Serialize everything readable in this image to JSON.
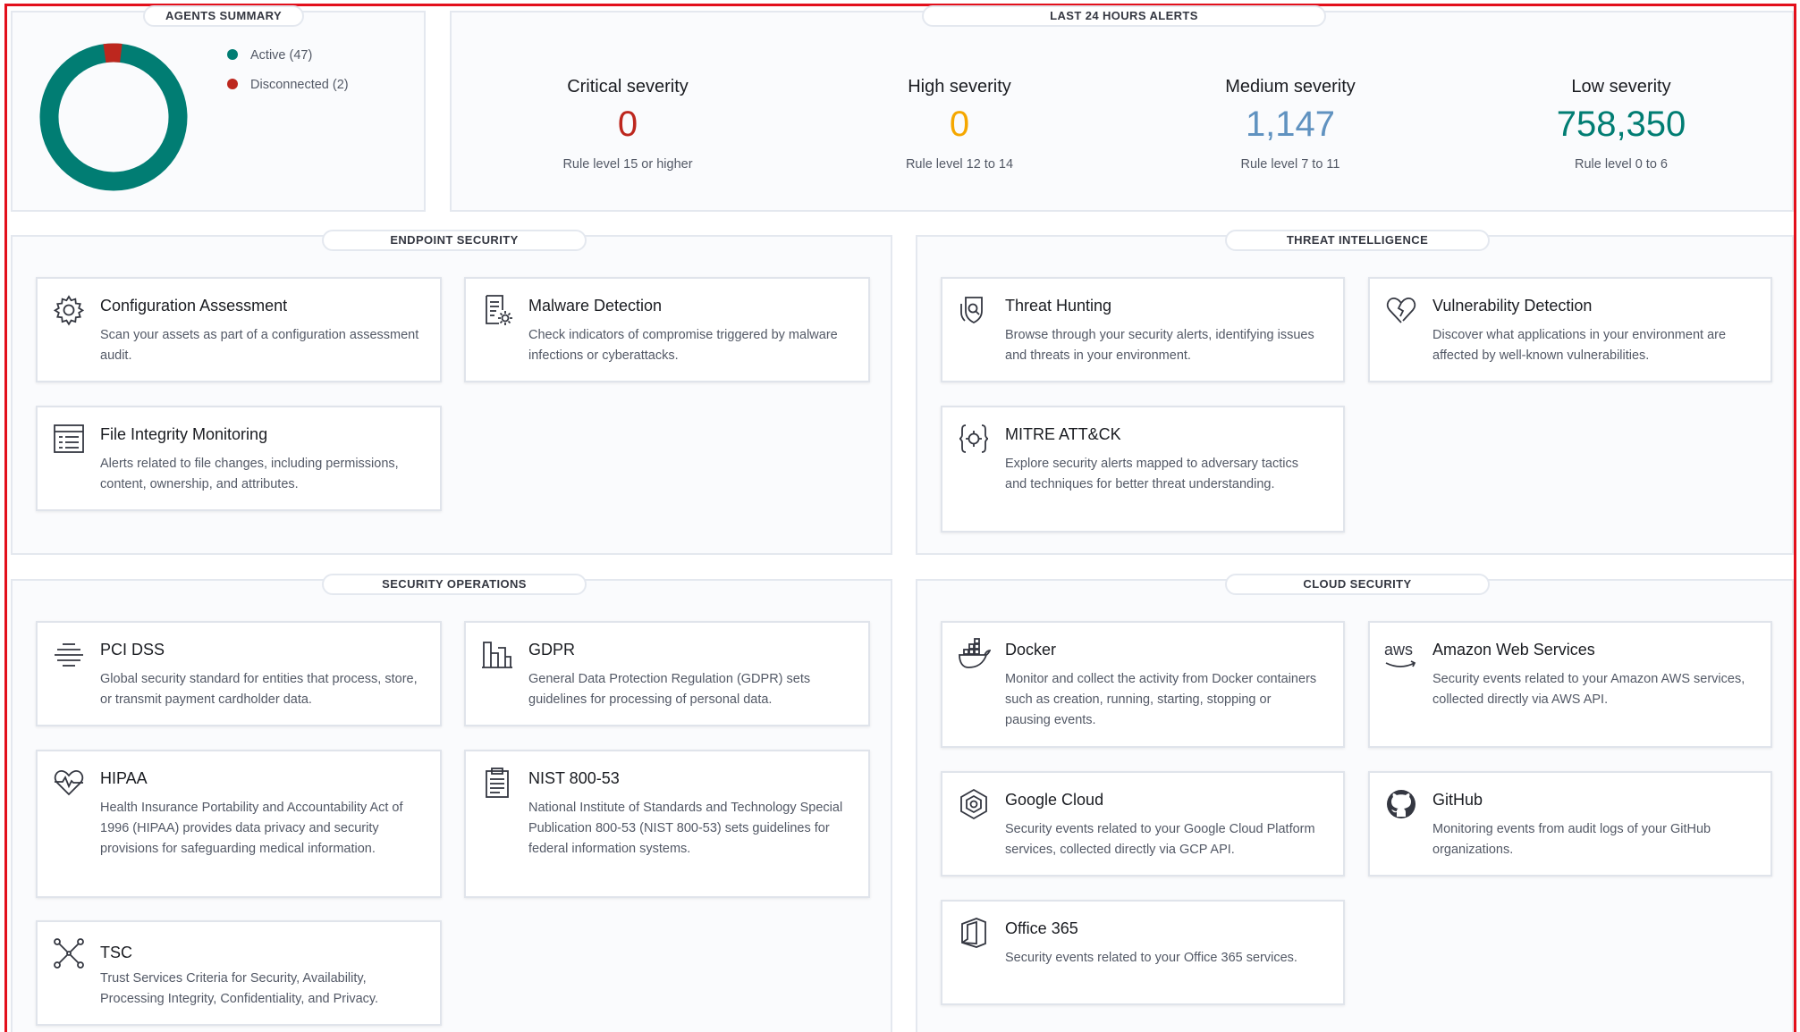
{
  "agents_summary": {
    "title": "AGENTS SUMMARY",
    "active_label": "Active (47)",
    "disconnected_label": "Disconnected (2)",
    "active_count": 47,
    "disconnected_count": 2,
    "active_color": "#017d73",
    "disconnected_color": "#bd271e"
  },
  "alerts": {
    "title": "LAST 24 HOURS ALERTS",
    "items": [
      {
        "title": "Critical severity",
        "value": "0",
        "rule": "Rule level 15 or higher",
        "color": "#bd271e"
      },
      {
        "title": "High severity",
        "value": "0",
        "rule": "Rule level 12 to 14",
        "color": "#f5a700"
      },
      {
        "title": "Medium severity",
        "value": "1,147",
        "rule": "Rule level 7 to 11",
        "color": "#6092c0"
      },
      {
        "title": "Low severity",
        "value": "758,350",
        "rule": "Rule level 0 to 6",
        "color": "#017d73"
      }
    ]
  },
  "sections": {
    "endpoint": {
      "title": "ENDPOINT SECURITY",
      "cards": [
        {
          "title": "Configuration Assessment",
          "desc": "Scan your assets as part of a configuration assessment audit.",
          "icon": "gear-icon"
        },
        {
          "title": "Malware Detection",
          "desc": "Check indicators of compromise triggered by malware infections or cyberattacks.",
          "icon": "document-gear-icon"
        },
        {
          "title": "File Integrity Monitoring",
          "desc": "Alerts related to file changes, including permissions, content, ownership, and attributes.",
          "icon": "list-document-icon"
        }
      ]
    },
    "threat": {
      "title": "THREAT INTELLIGENCE",
      "cards": [
        {
          "title": "Threat Hunting",
          "desc": "Browse through your security alerts, identifying issues and threats in your environment.",
          "icon": "shield-search-icon"
        },
        {
          "title": "Vulnerability Detection",
          "desc": "Discover what applications in your environment are affected by well-known vulnerabilities.",
          "icon": "broken-heart-icon"
        },
        {
          "title": "MITRE ATT&CK",
          "desc": "Explore security alerts mapped to adversary tactics and techniques for better threat understanding.",
          "icon": "target-brackets-icon"
        }
      ]
    },
    "secops": {
      "title": "SECURITY OPERATIONS",
      "cards": [
        {
          "title": "PCI DSS",
          "desc": "Global security standard for entities that process, store, or transmit payment cardholder data.",
          "icon": "lines-icon"
        },
        {
          "title": "GDPR",
          "desc": "General Data Protection Regulation (GDPR) sets guidelines for processing of personal data.",
          "icon": "building-icon"
        },
        {
          "title": "HIPAA",
          "desc": "Health Insurance Portability and Accountability Act of 1996 (HIPAA) provides data privacy and security provisions for safeguarding medical information.",
          "icon": "heartbeat-icon"
        },
        {
          "title": "NIST 800-53",
          "desc": "National Institute of Standards and Technology Special Publication 800-53 (NIST 800-53) sets guidelines for federal information systems.",
          "icon": "clipboard-icon"
        },
        {
          "title": "TSC",
          "desc": "Trust Services Criteria for Security, Availability, Processing Integrity, Confidentiality, and Privacy.",
          "icon": "network-icon"
        }
      ]
    },
    "cloud": {
      "title": "CLOUD SECURITY",
      "cards": [
        {
          "title": "Docker",
          "desc": "Monitor and collect the activity from Docker containers such as creation, running, starting, stopping or pausing events.",
          "icon": "docker-icon"
        },
        {
          "title": "Amazon Web Services",
          "desc": "Security events related to your Amazon AWS services, collected directly via AWS API.",
          "icon": "aws-icon",
          "icon_text": "aws"
        },
        {
          "title": "Google Cloud",
          "desc": "Security events related to your Google Cloud Platform services, collected directly via GCP API.",
          "icon": "google-cloud-icon"
        },
        {
          "title": "GitHub",
          "desc": "Monitoring events from audit logs of your GitHub organizations.",
          "icon": "github-icon"
        },
        {
          "title": "Office 365",
          "desc": "Security events related to your Office 365 services.",
          "icon": "office-icon"
        }
      ]
    }
  }
}
